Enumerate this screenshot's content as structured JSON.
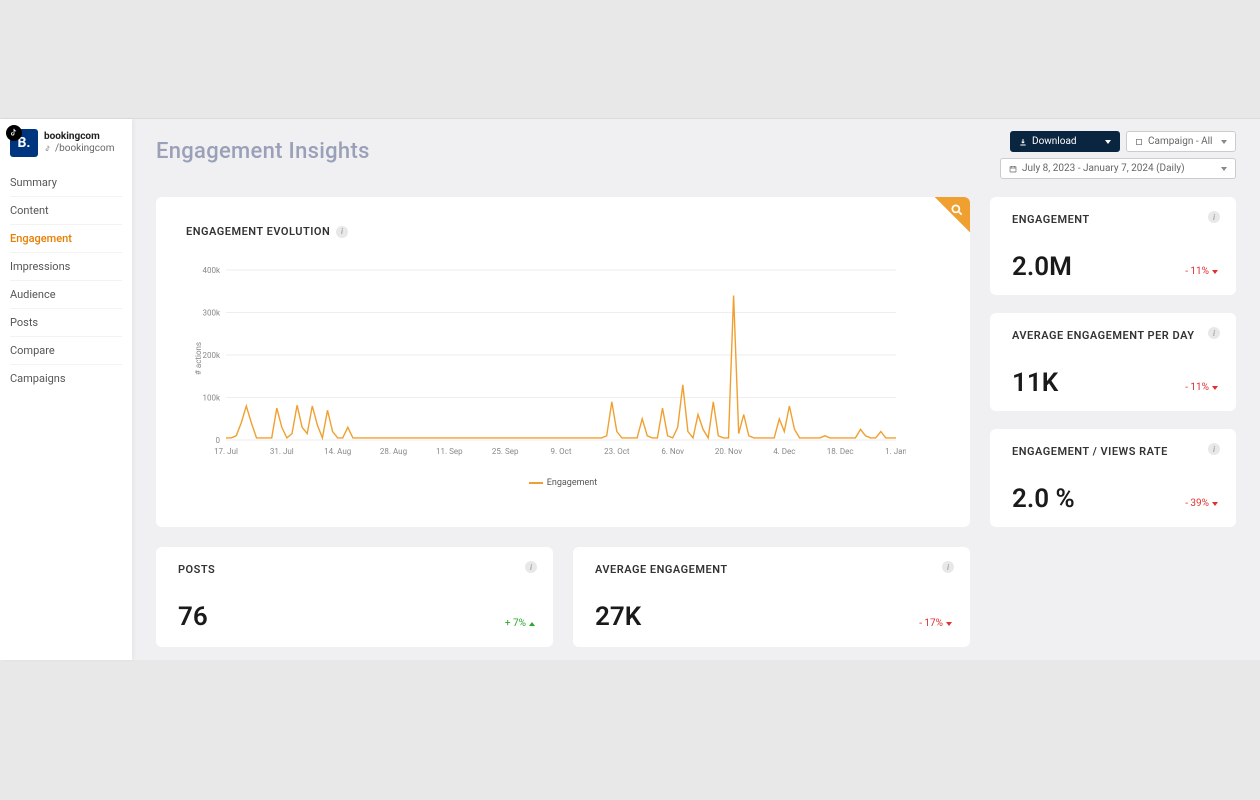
{
  "profile": {
    "logo_text": "B.",
    "name": "bookingcom",
    "handle": "/bookingcom"
  },
  "nav": {
    "items": [
      {
        "label": "Summary"
      },
      {
        "label": "Content"
      },
      {
        "label": "Engagement",
        "active": true
      },
      {
        "label": "Impressions"
      },
      {
        "label": "Audience"
      },
      {
        "label": "Posts"
      },
      {
        "label": "Compare"
      },
      {
        "label": "Campaigns"
      }
    ]
  },
  "page_title": "Engagement Insights",
  "controls": {
    "download": "Download",
    "campaign": "Campaign - All",
    "daterange": "July 8, 2023 - January 7, 2024 (Daily)"
  },
  "chart": {
    "title": "ENGAGEMENT EVOLUTION",
    "ylabel": "# actions",
    "legend": "Engagement"
  },
  "side_kpis": [
    {
      "title": "ENGAGEMENT",
      "value": "2.0M",
      "delta": "- 11%",
      "dir": "neg"
    },
    {
      "title": "AVERAGE ENGAGEMENT PER DAY",
      "value": "11K",
      "delta": "- 11%",
      "dir": "neg"
    },
    {
      "title": "ENGAGEMENT / VIEWS RATE",
      "value": "2.0 %",
      "delta": "- 39%",
      "dir": "neg"
    }
  ],
  "bottom_kpis": [
    {
      "title": "POSTS",
      "value": "76",
      "delta": "+ 7%",
      "dir": "pos"
    },
    {
      "title": "AVERAGE ENGAGEMENT",
      "value": "27K",
      "delta": "- 17%",
      "dir": "neg"
    }
  ],
  "chart_data": {
    "type": "line",
    "xlabel": "",
    "ylabel": "# actions",
    "ylim": [
      0,
      400000
    ],
    "y_ticks": [
      0,
      100000,
      200000,
      300000,
      400000
    ],
    "y_tick_labels": [
      "0",
      "100k",
      "200k",
      "300k",
      "400k"
    ],
    "x_tick_labels": [
      "17. Jul",
      "31. Jul",
      "14. Aug",
      "28. Aug",
      "11. Sep",
      "25. Sep",
      "9. Oct",
      "23. Oct",
      "6. Nov",
      "20. Nov",
      "4. Dec",
      "18. Dec",
      "1. Jan"
    ],
    "series": [
      {
        "name": "Engagement",
        "color": "#f0a030",
        "values": [
          5,
          5,
          10,
          40,
          80,
          40,
          5,
          5,
          5,
          5,
          75,
          30,
          5,
          15,
          82,
          30,
          15,
          80,
          35,
          5,
          70,
          20,
          5,
          5,
          30,
          5,
          5,
          5,
          5,
          5,
          5,
          5,
          5,
          5,
          5,
          5,
          5,
          5,
          5,
          5,
          5,
          5,
          5,
          5,
          5,
          5,
          5,
          5,
          5,
          5,
          5,
          5,
          5,
          5,
          5,
          5,
          5,
          5,
          5,
          5,
          5,
          5,
          5,
          5,
          5,
          5,
          5,
          5,
          5,
          5,
          5,
          5,
          5,
          5,
          5,
          10,
          90,
          20,
          5,
          5,
          5,
          5,
          50,
          10,
          5,
          5,
          75,
          10,
          5,
          30,
          130,
          20,
          5,
          60,
          25,
          5,
          90,
          10,
          5,
          5,
          340,
          15,
          60,
          10,
          5,
          5,
          5,
          5,
          5,
          50,
          20,
          80,
          25,
          5,
          5,
          5,
          5,
          5,
          10,
          5,
          5,
          5,
          5,
          5,
          5,
          25,
          10,
          5,
          5,
          20,
          5,
          5,
          5
        ]
      }
    ]
  }
}
